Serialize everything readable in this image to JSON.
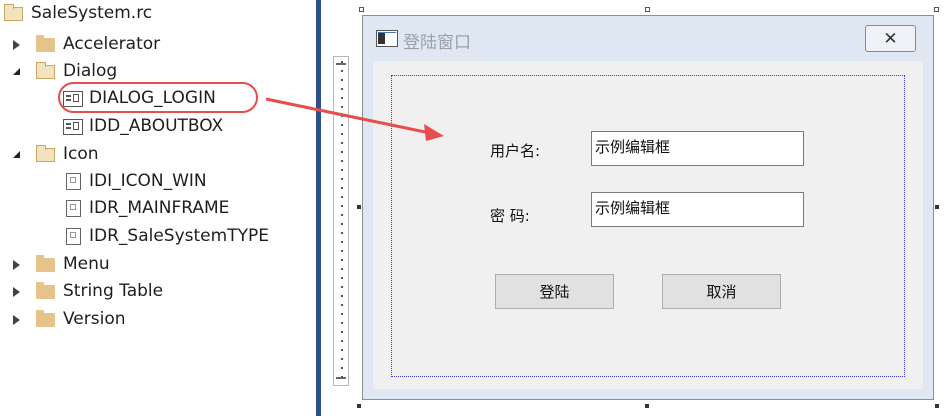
{
  "tree": {
    "root": "SaleSystem.rc",
    "accelerator": "Accelerator",
    "dialog": "Dialog",
    "dialog_login": "DIALOG_LOGIN",
    "idd_aboutbox": "IDD_ABOUTBOX",
    "icon": "Icon",
    "idi_icon_win": "IDI_ICON_WIN",
    "idr_mainframe": "IDR_MAINFRAME",
    "idr_salesystemtype": "IDR_SaleSystemTYPE",
    "menu": "Menu",
    "string_table": "String Table",
    "version": "Version"
  },
  "dialog": {
    "title": "登陆窗口",
    "close_symbol": "✕",
    "username_label": "用户名:",
    "username_value": "示例编辑框",
    "password_label": "密 码:",
    "password_value": "示例编辑框",
    "login_button": "登陆",
    "cancel_button": "取消"
  },
  "colors": {
    "annotation_red": "#e84d4d",
    "separator_blue": "#2d4f8a",
    "guide_blue": "#3a3ad0"
  }
}
